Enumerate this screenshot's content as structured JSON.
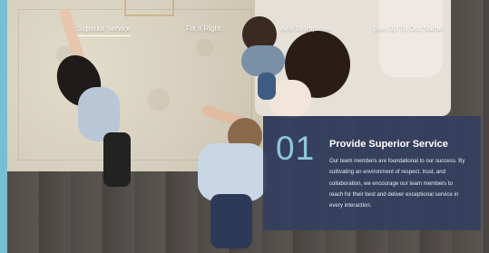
{
  "nav": {
    "items": [
      {
        "label": "Superior Service",
        "active": true
      },
      {
        "label": "Fix It Right",
        "active": false
      },
      {
        "label": "Aim To Improve",
        "active": false
      },
      {
        "label": "Live Up To Our Name",
        "active": false
      }
    ]
  },
  "panel": {
    "number": "01",
    "title": "Provide Superior Service",
    "text": "Our team members are foundational to our success. By cultivating an environment of respect, trust, and collaboration, we encourage our team members to reach for their best and deliver exceptional service in every interaction."
  },
  "colors": {
    "panel_bg": "#343f5f",
    "number_accent": "#8ec8d8",
    "left_edge": "#77bfd0"
  }
}
